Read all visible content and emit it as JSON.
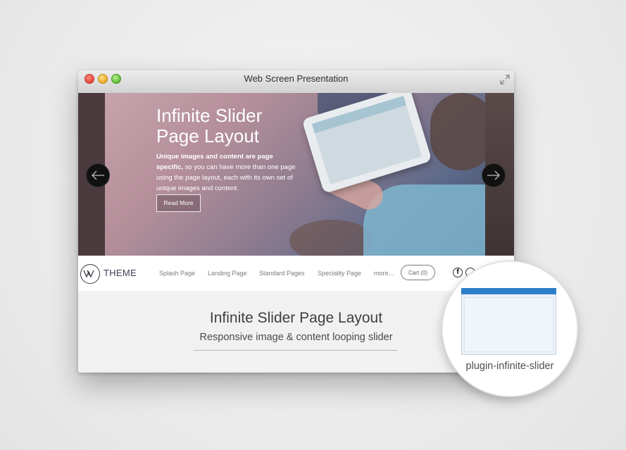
{
  "window": {
    "title": "Web Screen Presentation",
    "controls": [
      "close",
      "minimize",
      "zoom"
    ],
    "resize_icon": "fullscreen-arrows-icon"
  },
  "hero": {
    "title_line1": "Infinite Slider",
    "title_line2": "Page Layout",
    "lead_bold": "Unique images and content are page specific,",
    "lead_rest": " so you can have more than one page using the page layout, each with its own set of unique images and content.",
    "button_label": "Read More",
    "prev_icon": "arrow-left-icon",
    "next_icon": "arrow-right-icon"
  },
  "navbar": {
    "logo_text": "THEME",
    "items": [
      "Splash Page",
      "Landing Page",
      "Standard Pages",
      "Speciality Page",
      "more..."
    ],
    "cart_label": "Cart (0)",
    "social_icons": [
      "facebook-icon",
      "twitter-icon"
    ]
  },
  "content": {
    "title": "Infinite Slider Page Layout",
    "subtitle": "Responsive image & content looping slider"
  },
  "magnifier": {
    "label": "plugin-infinite-slider",
    "accent_color": "#2d7ec8"
  }
}
